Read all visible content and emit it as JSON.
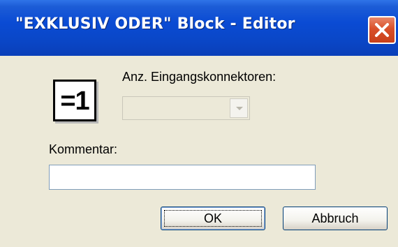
{
  "window": {
    "title": "\"EXKLUSIV ODER\" Block - Editor",
    "close_icon": "close-icon"
  },
  "gate": {
    "symbol": "=1",
    "icon": "xor-gate-icon"
  },
  "inputs_count": {
    "label": "Anz. Eingangskonnektoren:",
    "value": "",
    "disabled": true,
    "arrow_icon": "chevron-down-icon"
  },
  "comment": {
    "label": "Kommentar:",
    "value": ""
  },
  "buttons": {
    "ok_label": "OK",
    "cancel_label": "Abbruch"
  },
  "colors": {
    "titlebar": "#0a47c8",
    "close_button": "#d9502a",
    "dialog_bg": "#ece9d8"
  }
}
